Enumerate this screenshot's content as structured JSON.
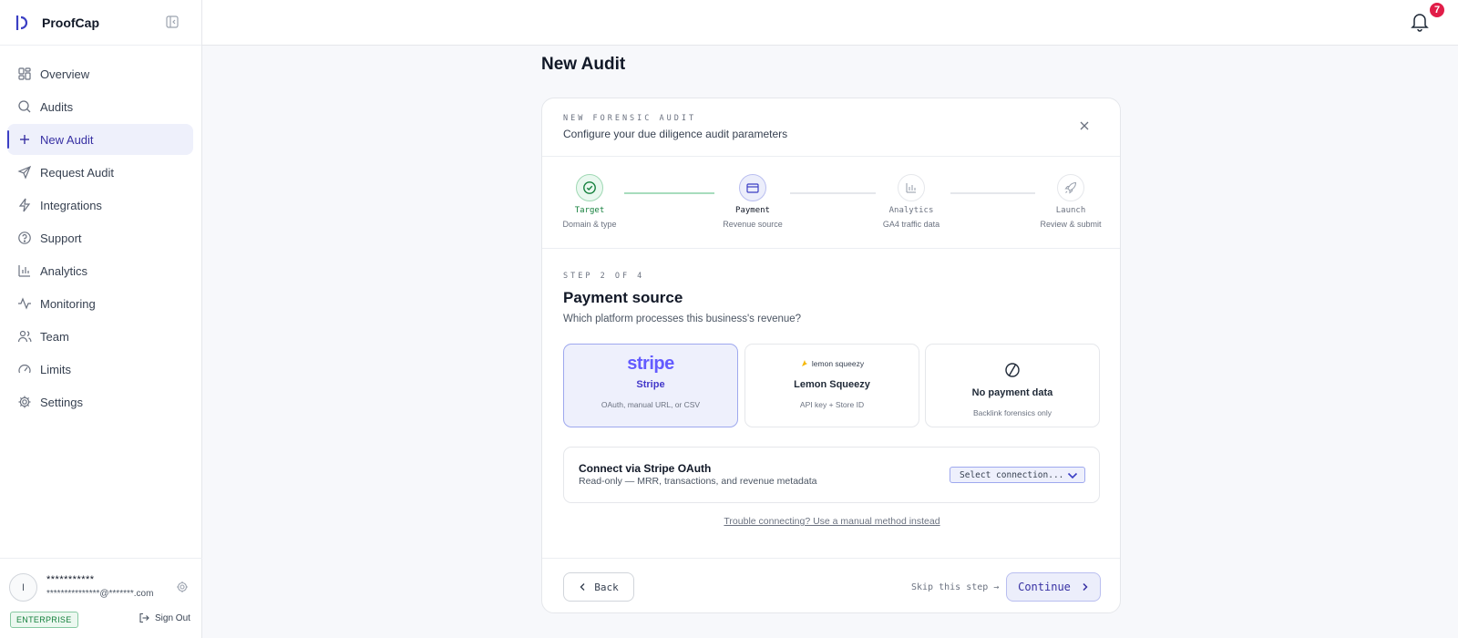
{
  "app": {
    "name": "ProofCap",
    "notification_count": "7"
  },
  "sidebar": {
    "items": [
      {
        "label": "Overview",
        "icon": "grid-icon"
      },
      {
        "label": "Audits",
        "icon": "search-icon"
      },
      {
        "label": "New Audit",
        "icon": "plus-icon",
        "active": true
      },
      {
        "label": "Request Audit",
        "icon": "send-icon"
      },
      {
        "label": "Integrations",
        "icon": "lightning-icon"
      },
      {
        "label": "Support",
        "icon": "help-circle-icon"
      },
      {
        "label": "Analytics",
        "icon": "bar-chart-icon"
      },
      {
        "label": "Monitoring",
        "icon": "activity-icon"
      },
      {
        "label": "Team",
        "icon": "users-icon"
      },
      {
        "label": "Limits",
        "icon": "gauge-icon"
      },
      {
        "label": "Settings",
        "icon": "gear-icon"
      }
    ],
    "user": {
      "initial": "I",
      "name": "***********",
      "email": "***************@*******.com",
      "plan": "ENTERPRISE",
      "sign_out": "Sign Out"
    }
  },
  "page": {
    "title": "New Audit"
  },
  "card": {
    "eyebrow": "NEW FORENSIC AUDIT",
    "subtitle": "Configure your due diligence audit parameters",
    "steps": [
      {
        "title": "Target",
        "sub": "Domain & type",
        "state": "done"
      },
      {
        "title": "Payment",
        "sub": "Revenue source",
        "state": "current"
      },
      {
        "title": "Analytics",
        "sub": "GA4 traffic data",
        "state": "upcoming"
      },
      {
        "title": "Launch",
        "sub": "Review & submit",
        "state": "upcoming"
      }
    ],
    "step_of": "STEP 2 OF 4",
    "section_title": "Payment source",
    "section_question": "Which platform processes this business's revenue?",
    "options": [
      {
        "logo": "stripe",
        "name": "Stripe",
        "desc": "OAuth, manual URL, or CSV",
        "selected": true
      },
      {
        "logo": "lemon squeezy",
        "name": "Lemon Squeezy",
        "desc": "API key + Store ID",
        "selected": false
      },
      {
        "logo": "",
        "name": "No payment data",
        "desc": "Backlink forensics only",
        "selected": false
      }
    ],
    "connect": {
      "title": "Connect via Stripe OAuth",
      "sub": "Read-only — MRR, transactions, and revenue metadata",
      "select_value": "Select connection..."
    },
    "trouble_link": "Trouble connecting? Use a manual method instead",
    "footer": {
      "back": "Back",
      "skip": "Skip this step →",
      "continue": "Continue"
    }
  },
  "colors": {
    "accent": "#3b3fc4",
    "stripe": "#635bff",
    "success": "#15803d",
    "alert": "#e11d48"
  }
}
